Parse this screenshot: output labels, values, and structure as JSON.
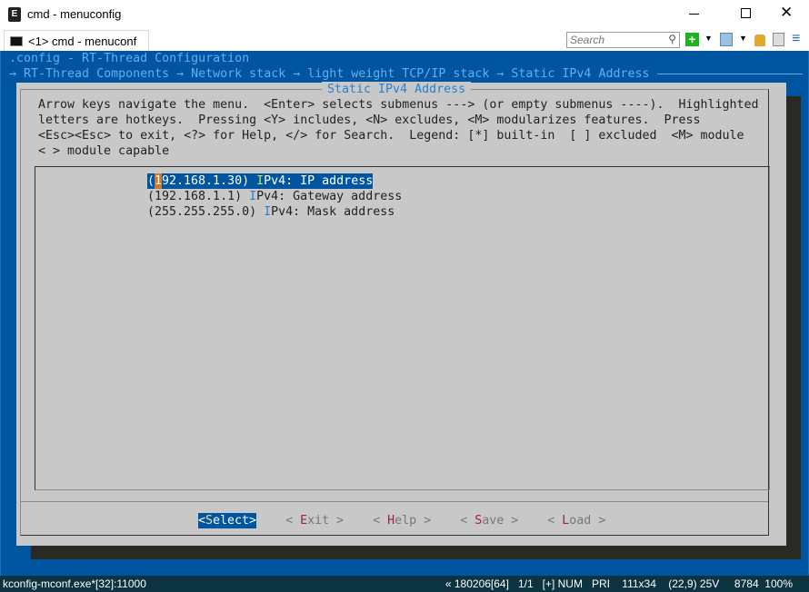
{
  "window": {
    "title": "cmd - menuconfig",
    "tab": "<1> cmd - menuconf",
    "search_placeholder": "Search"
  },
  "terminal": {
    "config_title": ".config - RT-Thread Configuration",
    "breadcrumb": "→ RT-Thread Components → Network stack → light weight TCP/IP stack → Static IPv4 Address",
    "dialog_title": "Static IPv4 Address",
    "help_lines": [
      "Arrow keys navigate the menu.  <Enter> selects submenus ---> (or empty submenus ----).  Highlighted",
      "letters are hotkeys.  Pressing <Y> includes, <N> excludes, <M> modularizes features.  Press",
      "<Esc><Esc> to exit, <?> for Help, </> for Search.  Legend: [*] built-in  [ ] excluded  <M> module",
      "< > module capable"
    ],
    "items": [
      {
        "value": "192.168.1.30",
        "hotkey": "I",
        "label": "Pv4: IP address",
        "selected": true
      },
      {
        "value": "192.168.1.1",
        "hotkey": "I",
        "label": "Pv4: Gateway address",
        "selected": false
      },
      {
        "value": "255.255.255.0",
        "hotkey": "I",
        "label": "Pv4: Mask address",
        "selected": false
      }
    ],
    "buttons": [
      {
        "pre": "<",
        "hk": "S",
        "rest": "elect>",
        "selected": true
      },
      {
        "pre": "< ",
        "hk": "E",
        "rest": "xit >",
        "selected": false
      },
      {
        "pre": "< ",
        "hk": "H",
        "rest": "elp >",
        "selected": false
      },
      {
        "pre": "< ",
        "hk": "S",
        "rest": "ave >",
        "selected": false
      },
      {
        "pre": "< ",
        "hk": "L",
        "rest": "oad >",
        "selected": false
      }
    ]
  },
  "statusbar": {
    "left": "kconfig-mconf.exe*[32]:11000",
    "right": "« 180206[64]   1/1   [+] NUM   PRI    111x34    (22,9) 25V     8784  100%"
  },
  "colors": {
    "terminal_bg": "#0055a0",
    "dialog_bg": "#c8c8c8",
    "highlight": "#0055a0",
    "hotkey": "#a02040"
  }
}
